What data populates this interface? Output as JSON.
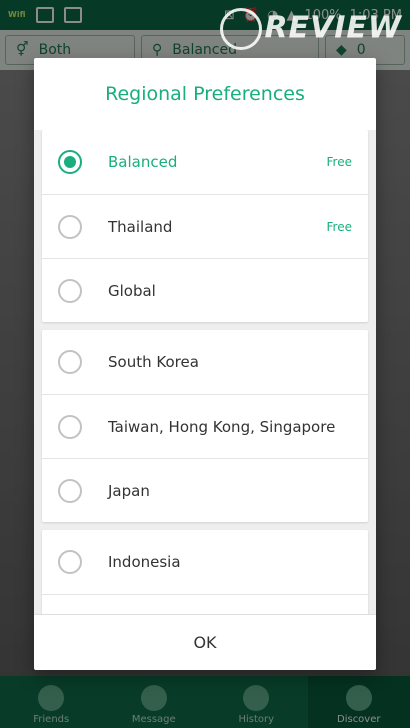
{
  "status_bar": {
    "wifi_tag": "Wifi",
    "battery": "100%",
    "time": "1:03 PM"
  },
  "background": {
    "filter": {
      "gender": "Both",
      "region": "Balanced",
      "gems": "0"
    },
    "nav": [
      "Friends",
      "Message",
      "History",
      "Discover"
    ]
  },
  "dialog": {
    "title": "Regional Preferences",
    "ok_label": "OK",
    "groups": [
      [
        {
          "label": "Balanced",
          "badge": "Free",
          "selected": true
        },
        {
          "label": "Thailand",
          "badge": "Free",
          "selected": false
        },
        {
          "label": "Global",
          "badge": "",
          "selected": false
        }
      ],
      [
        {
          "label": "South Korea",
          "badge": "",
          "selected": false
        },
        {
          "label": "Taiwan, Hong Kong, Singapore",
          "badge": "",
          "selected": false
        },
        {
          "label": "Japan",
          "badge": "",
          "selected": false
        }
      ],
      [
        {
          "label": "Indonesia",
          "badge": "",
          "selected": false
        }
      ]
    ]
  },
  "watermark": {
    "text": "REVIEW"
  },
  "colors": {
    "accent": "#1aae7f",
    "app_green": "#0d6b46"
  }
}
